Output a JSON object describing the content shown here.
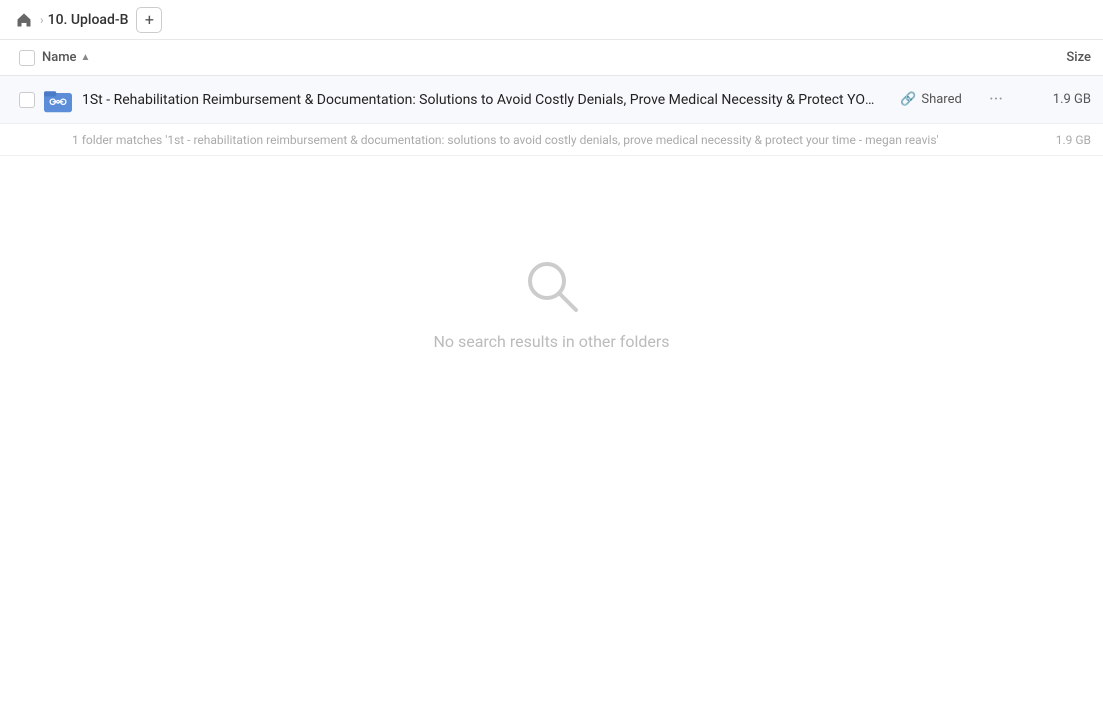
{
  "breadcrumb": {
    "home_label": "Home",
    "folder_name": "10. Upload-B",
    "add_label": "+"
  },
  "columns": {
    "name_label": "Name",
    "size_label": "Size",
    "sort_indicator": "▲"
  },
  "file_row": {
    "name": "1St - Rehabilitation Reimbursement & Documentation: Solutions to Avoid Costly Denials, Prove Medical Necessity & Protect YOUR T...",
    "shared_label": "Shared",
    "size": "1.9 GB",
    "more_label": "···"
  },
  "match_hint": {
    "text": "1 folder matches '1st - rehabilitation reimbursement & documentation: solutions to avoid costly denials, prove medical necessity & protect your time - megan reavis'",
    "size": "1.9 GB"
  },
  "empty_state": {
    "message": "No search results in other folders"
  }
}
